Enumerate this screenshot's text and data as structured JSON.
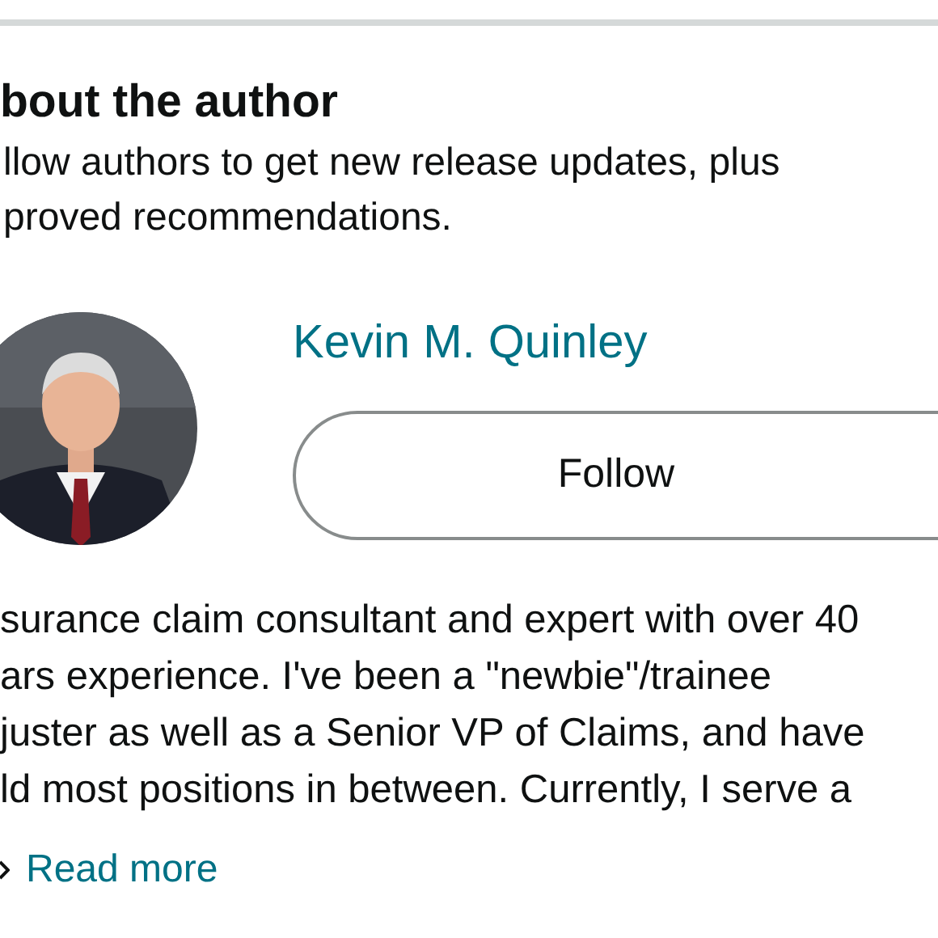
{
  "heading": "bout the author",
  "intro": [
    "llow authors to get new release updates, plus",
    "proved recommendations."
  ],
  "author": {
    "name": "Kevin M. Quinley"
  },
  "follow_button": "Follow",
  "bio": [
    "surance claim consultant and expert with over 40",
    "ars experience. I've been a \"newbie\"/trainee",
    "juster as well as a Senior VP of Claims, and have",
    "ld most positions in between. Currently, I serve a"
  ],
  "read_more": "Read more"
}
